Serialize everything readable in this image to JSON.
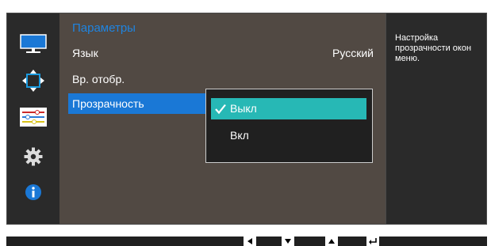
{
  "menu": {
    "title": "Параметры",
    "items": [
      {
        "label": "Язык",
        "value": "Русский"
      },
      {
        "label": "Вр. отобр."
      },
      {
        "label": "Прозрачность"
      }
    ]
  },
  "popup": {
    "options": [
      {
        "label": "Выкл",
        "selected": true
      },
      {
        "label": "Вкл",
        "selected": false
      }
    ]
  },
  "help": {
    "text": "Настройка прозрачности окон меню."
  },
  "sidebar": {
    "icons": [
      "monitor-icon",
      "move-arrows-icon",
      "sliders-icon",
      "gear-icon",
      "info-icon"
    ]
  },
  "nav": {
    "buttons": [
      "left-arrow-icon",
      "down-arrow-icon",
      "up-arrow-icon",
      "enter-icon"
    ]
  },
  "colors": {
    "title_blue": "#1f84e0",
    "selection_blue": "#1a78d6",
    "option_teal": "#27b8b5"
  }
}
